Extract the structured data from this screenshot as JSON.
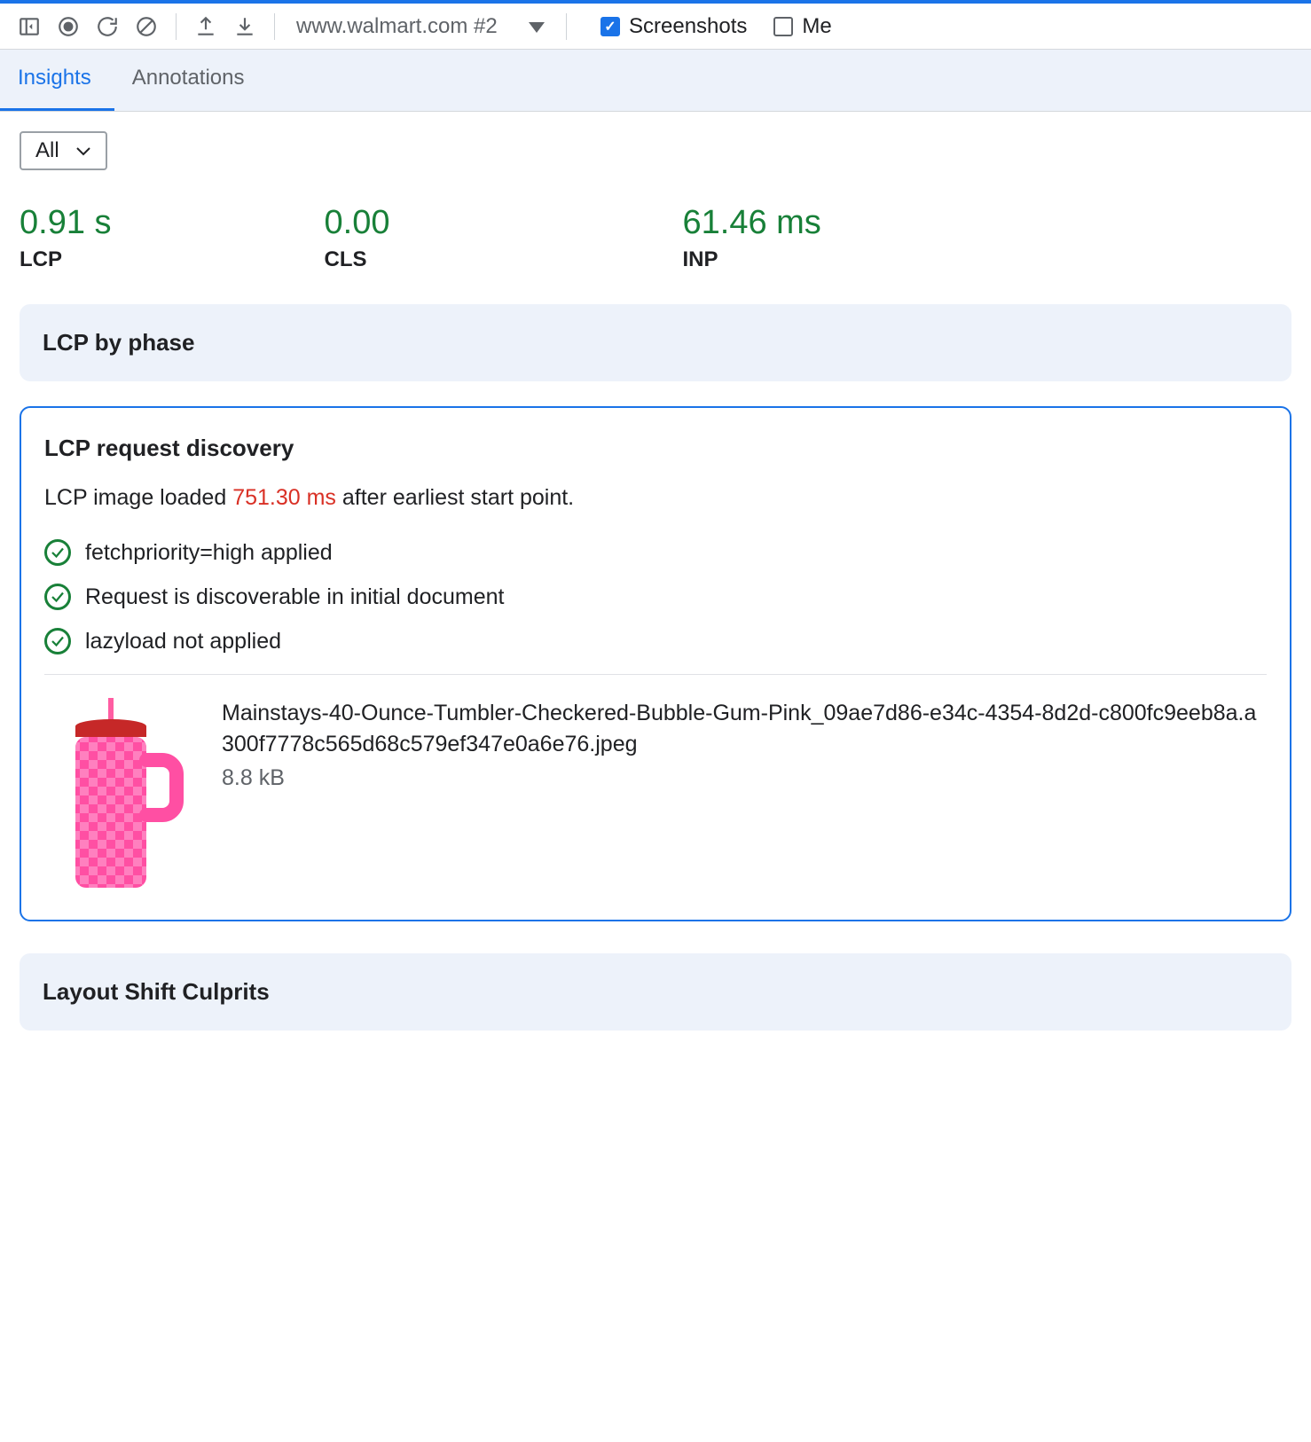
{
  "toolbar": {
    "recording_label": "www.walmart.com #2",
    "screenshots_label": "Screenshots",
    "memory_label": "Me"
  },
  "tabs": {
    "insights": "Insights",
    "annotations": "Annotations"
  },
  "filter": {
    "selected": "All"
  },
  "metrics": {
    "lcp": {
      "value": "0.91 s",
      "label": "LCP"
    },
    "cls": {
      "value": "0.00",
      "label": "CLS"
    },
    "inp": {
      "value": "61.46 ms",
      "label": "INP"
    }
  },
  "cards": {
    "lcp_phase_title": "LCP by phase",
    "discovery": {
      "title": "LCP request discovery",
      "prefix": "LCP image loaded ",
      "delay": "751.30 ms",
      "suffix": " after earliest start point.",
      "checks": [
        "fetchpriority=high applied",
        "Request is discoverable in initial document",
        "lazyload not applied"
      ],
      "filename": "Mainstays-40-Ounce-Tumbler-Checkered-Bubble-Gum-Pink_09ae7d86-e34c-4354-8d2d-c800fc9eeb8a.a300f7778c565d68c579ef347e0a6e76.jpeg",
      "filesize": "8.8 kB"
    },
    "layout_shift_title": "Layout Shift Culprits"
  }
}
